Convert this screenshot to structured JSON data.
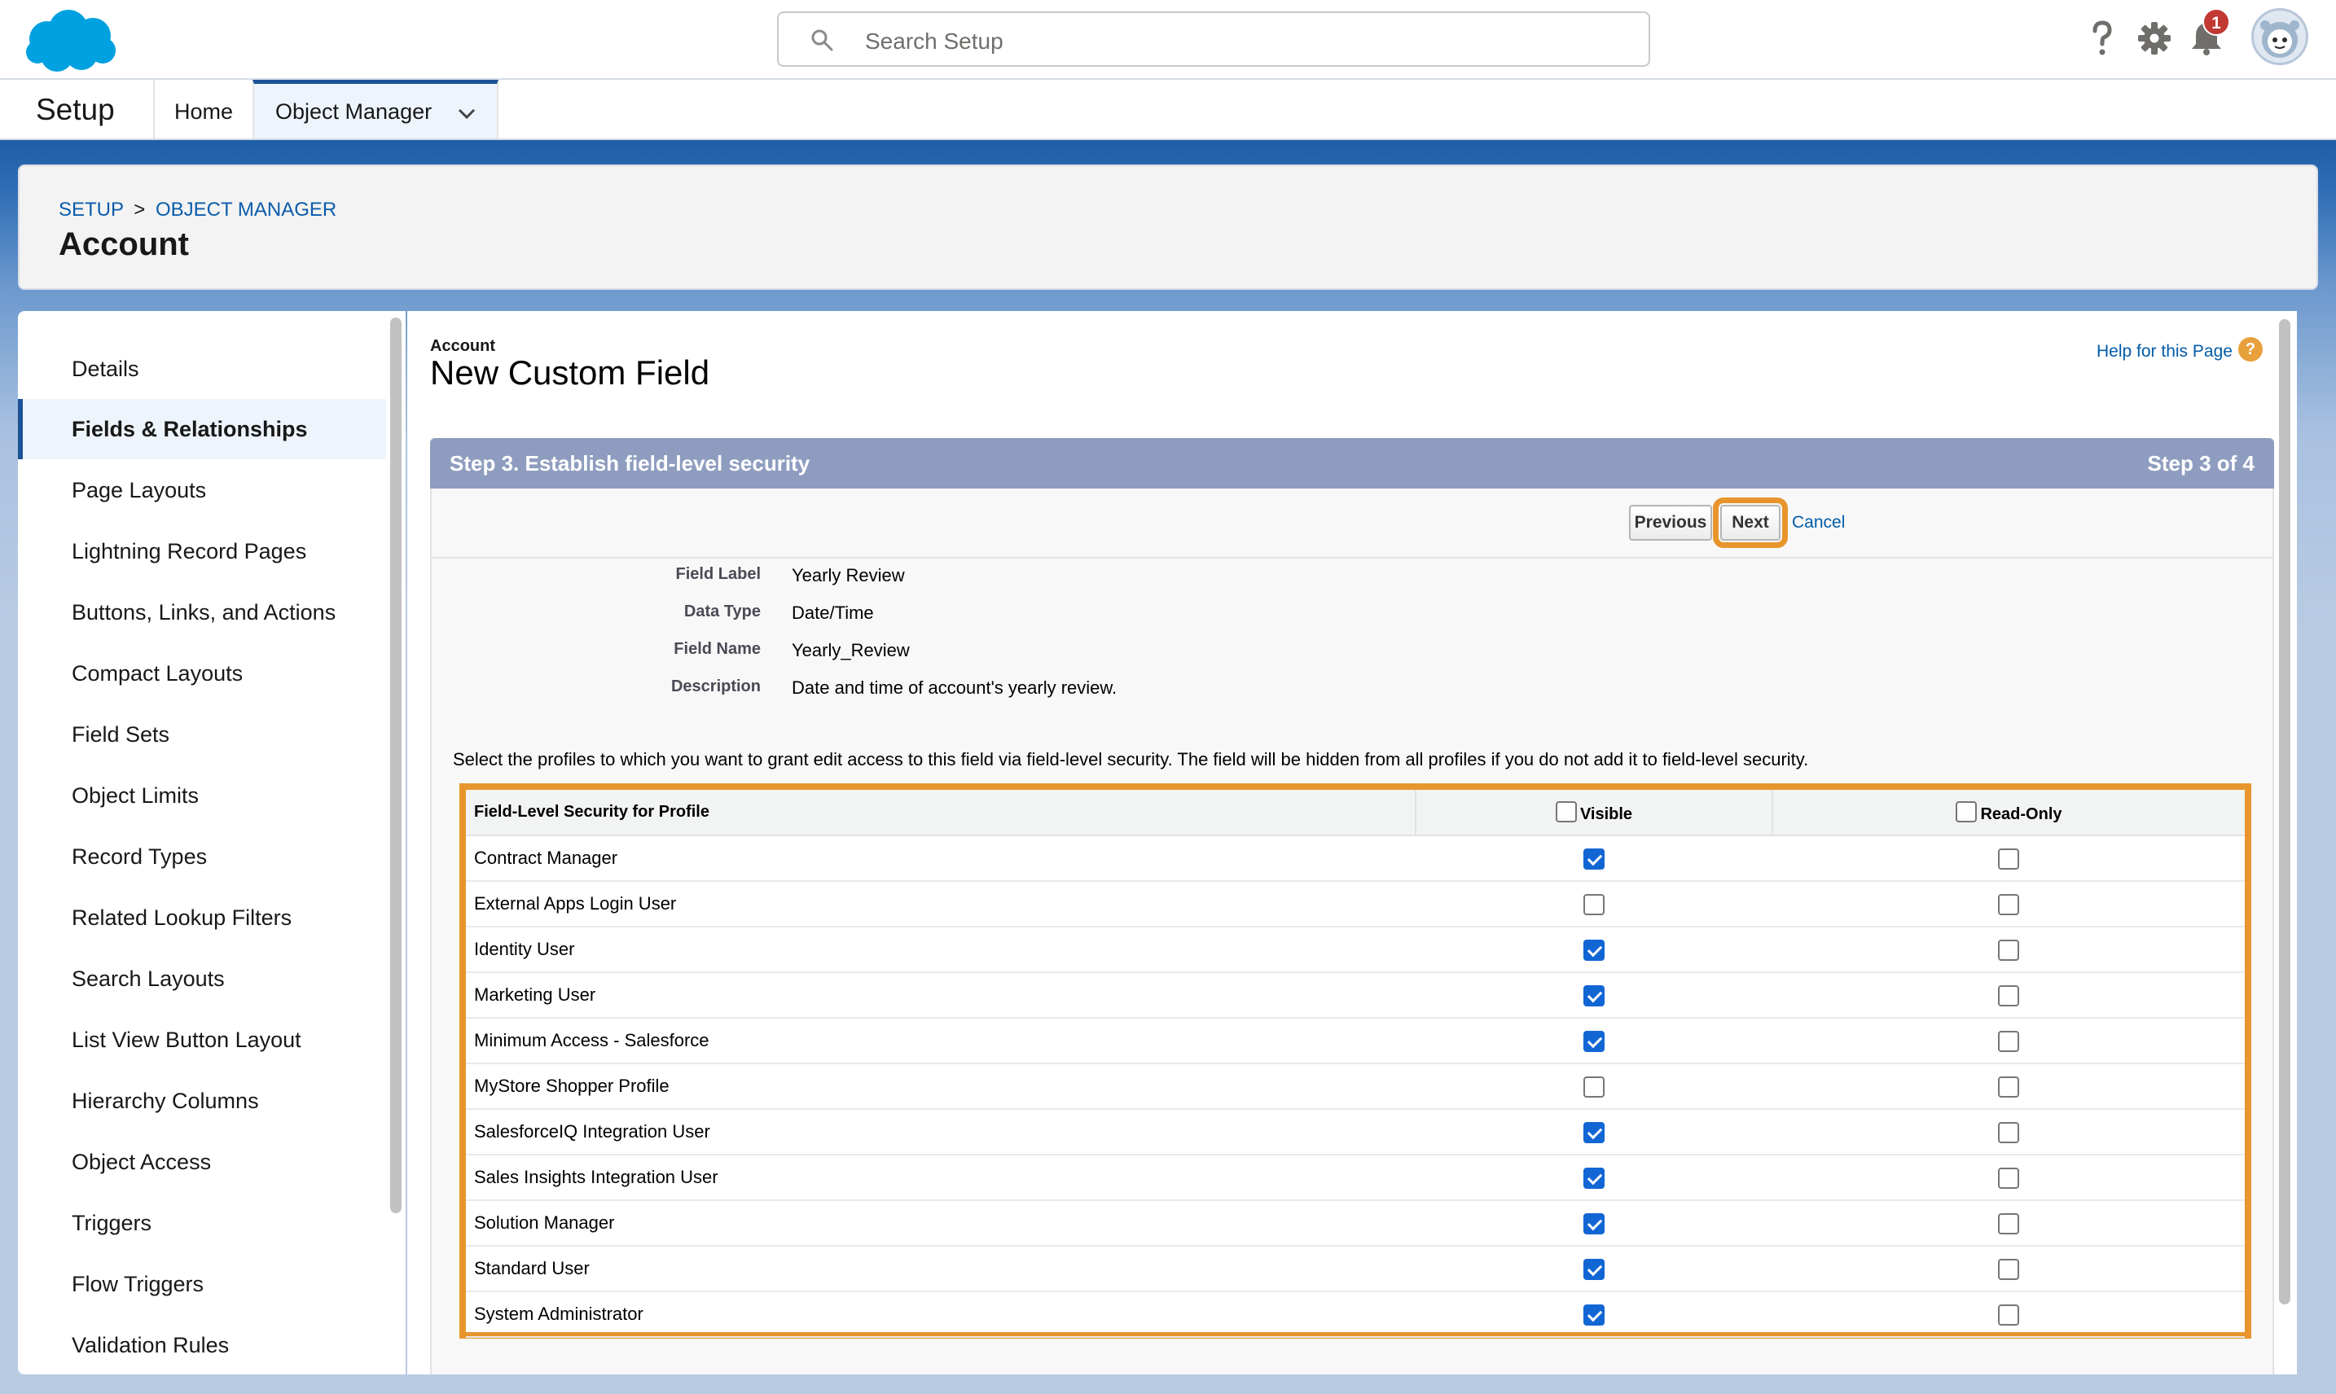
{
  "header": {
    "search_placeholder": "Search Setup",
    "notification_count": "1",
    "icons": [
      "salesforce-cloud-logo",
      "search-icon",
      "help-icon",
      "gear-icon",
      "bell-icon",
      "avatar"
    ]
  },
  "context_bar": {
    "app_name": "Setup",
    "tabs": [
      {
        "label": "Home",
        "active": false
      },
      {
        "label": "Object Manager",
        "active": true
      }
    ]
  },
  "title_card": {
    "breadcrumb": [
      "SETUP",
      "OBJECT MANAGER"
    ],
    "breadcrumb_separator": ">",
    "title": "Account"
  },
  "sidebar": {
    "items": [
      {
        "label": "Details",
        "active": false
      },
      {
        "label": "Fields & Relationships",
        "active": true
      },
      {
        "label": "Page Layouts",
        "active": false
      },
      {
        "label": "Lightning Record Pages",
        "active": false
      },
      {
        "label": "Buttons, Links, and Actions",
        "active": false
      },
      {
        "label": "Compact Layouts",
        "active": false
      },
      {
        "label": "Field Sets",
        "active": false
      },
      {
        "label": "Object Limits",
        "active": false
      },
      {
        "label": "Record Types",
        "active": false
      },
      {
        "label": "Related Lookup Filters",
        "active": false
      },
      {
        "label": "Search Layouts",
        "active": false
      },
      {
        "label": "List View Button Layout",
        "active": false
      },
      {
        "label": "Hierarchy Columns",
        "active": false
      },
      {
        "label": "Object Access",
        "active": false
      },
      {
        "label": "Triggers",
        "active": false
      },
      {
        "label": "Flow Triggers",
        "active": false
      },
      {
        "label": "Validation Rules",
        "active": false
      }
    ]
  },
  "main": {
    "object_label": "Account",
    "form_title": "New Custom Field",
    "help_link": "Help for this Page",
    "help_icon_glyph": "?",
    "step_title": "Step 3. Establish field-level security",
    "step_count": "Step 3 of 4",
    "buttons": {
      "previous": "Previous",
      "next": "Next",
      "cancel": "Cancel"
    },
    "field_info": [
      {
        "label": "Field Label",
        "value": "Yearly Review"
      },
      {
        "label": "Data Type",
        "value": "Date/Time"
      },
      {
        "label": "Field Name",
        "value": "Yearly_Review"
      },
      {
        "label": "Description",
        "value": "Date and time of account's yearly review."
      }
    ],
    "instructions": "Select the profiles to which you want to grant edit access to this field via field-level security. The field will be hidden from all profiles if you do not add it to field-level security.",
    "fls_table": {
      "headers": {
        "profile": "Field-Level Security for Profile",
        "visible": "Visible",
        "read_only": "Read-Only"
      },
      "rows": [
        {
          "profile": "Contract Manager",
          "visible": true,
          "read_only": false
        },
        {
          "profile": "External Apps Login User",
          "visible": false,
          "read_only": false
        },
        {
          "profile": "Identity User",
          "visible": true,
          "read_only": false
        },
        {
          "profile": "Marketing User",
          "visible": true,
          "read_only": false
        },
        {
          "profile": "Minimum Access - Salesforce",
          "visible": true,
          "read_only": false
        },
        {
          "profile": "MyStore Shopper Profile",
          "visible": false,
          "read_only": false
        },
        {
          "profile": "SalesforceIQ Integration User",
          "visible": true,
          "read_only": false
        },
        {
          "profile": "Sales Insights Integration User",
          "visible": true,
          "read_only": false
        },
        {
          "profile": "Solution Manager",
          "visible": true,
          "read_only": false
        },
        {
          "profile": "Standard User",
          "visible": true,
          "read_only": false
        },
        {
          "profile": "System Administrator",
          "visible": true,
          "read_only": false
        }
      ]
    }
  },
  "colors": {
    "brand_blue": "#1b5297",
    "link_blue": "#015ba7",
    "highlight_orange": "#e8952d",
    "step_header": "#8e9dbf",
    "checkbox_blue": "#1266d4",
    "badge_red": "#c23934"
  }
}
